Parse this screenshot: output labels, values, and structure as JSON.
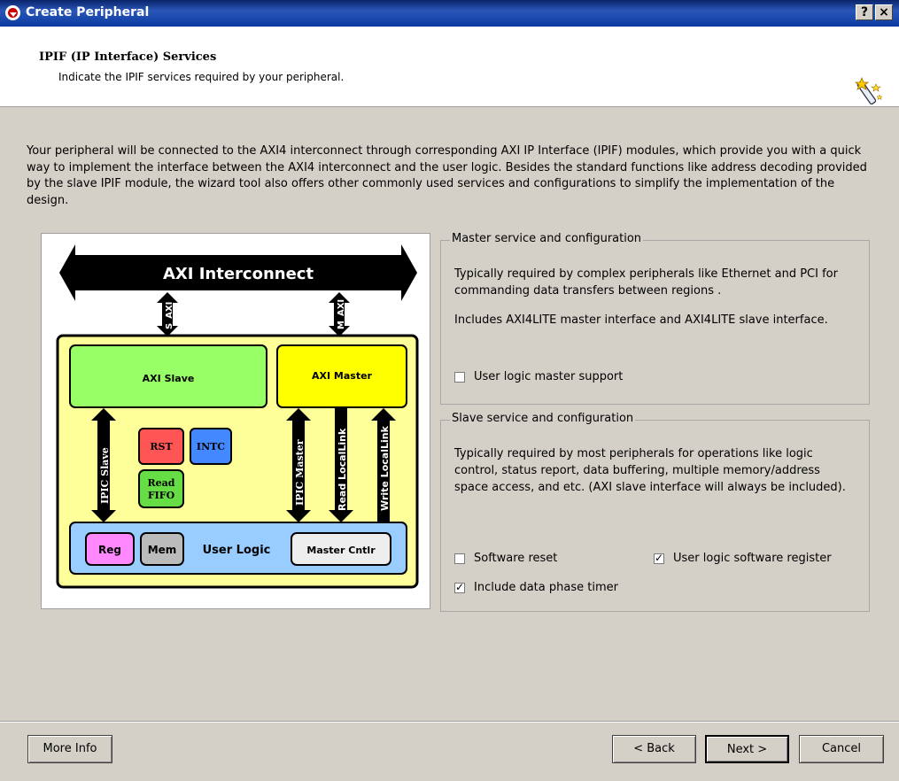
{
  "window": {
    "title": "Create Peripheral",
    "help_label": "?",
    "close_label": "×"
  },
  "header": {
    "title": "IPIF (IP Interface) Services",
    "subtitle": "Indicate the IPIF services required by your peripheral.",
    "icon": "wizard-wand-icon"
  },
  "intro_text": "Your peripheral will be connected to the AXI4 interconnect through corresponding AXI IP Interface (IPIF) modules, which provide you with a quick way to implement the interface between the AXI4 interconnect and the user logic. Besides the standard functions like address decoding provided by the slave IPIF module, the wizard tool also offers other commonly used services and configurations to simplify the implementation of the design.",
  "diagram": {
    "interconnect": "AXI Interconnect",
    "s_axi": "S_AXI",
    "m_axi": "M_AXI",
    "axi_slave": "AXI Slave",
    "axi_master": "AXI Master",
    "rst": "RST",
    "intc": "INTC",
    "read": "Read",
    "fifo": "FIFO",
    "ipic_slave": "IPIC Slave",
    "ipic_master": "IPIC Master",
    "read_locallink": "Read LocalLink",
    "write_locallink": "Write LocalLink",
    "reg": "Reg",
    "mem": "Mem",
    "user_logic": "User Logic",
    "master_cntlr": "Master Cntlr"
  },
  "master_group": {
    "legend": "Master service and configuration",
    "text1": "Typically required by complex peripherals like Ethernet and PCI for commanding data transfers between regions .",
    "text2": "Includes AXI4LITE master interface and AXI4LITE slave interface.",
    "master_support": {
      "label": "User logic master support",
      "checked": false
    }
  },
  "slave_group": {
    "legend": "Slave service and configuration",
    "text": "Typically required by most peripherals for operations like logic control, status report, data buffering, multiple memory/address space access, and etc. (AXI slave interface will always be included).",
    "software_reset": {
      "label": "Software reset",
      "checked": false
    },
    "software_register": {
      "label": "User logic software register",
      "checked": true
    },
    "data_phase_timer": {
      "label": "Include data phase timer",
      "checked": true
    }
  },
  "buttons": {
    "more_info": "More Info",
    "back": "< Back",
    "next": "Next >",
    "cancel": "Cancel"
  },
  "colors": {
    "dialog_bg": "#d4d0c8",
    "title_bar": "#0a246a",
    "user_logic_box": "#ffff99",
    "axi_slave": "#99ff66",
    "axi_master": "#ffff00",
    "rst": "#ff5555",
    "intc": "#4488ff",
    "read_fifo": "#66dd44",
    "user_logic_bar": "#99ccff",
    "reg": "#ff88ff",
    "mem": "#bbbbbb"
  }
}
